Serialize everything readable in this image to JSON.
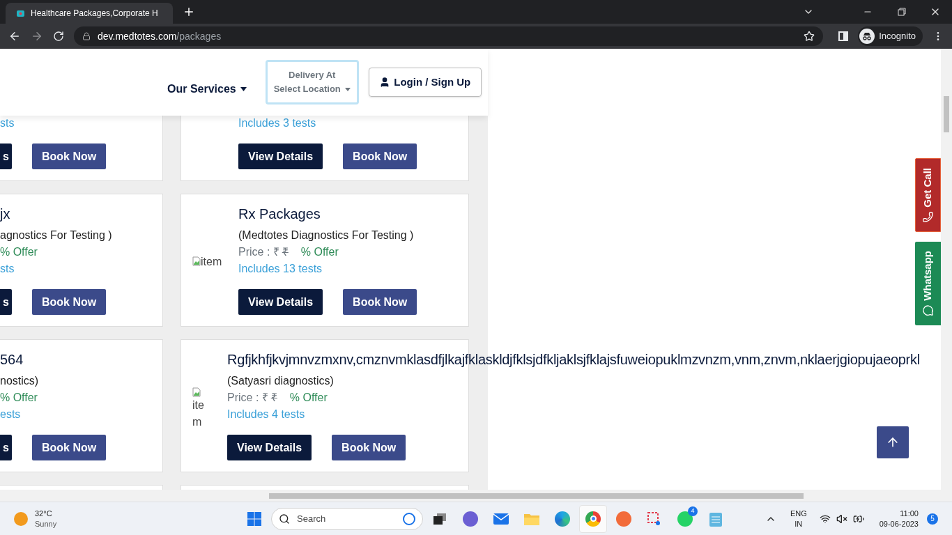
{
  "browser": {
    "tab_title": "Healthcare Packages,Corporate H",
    "url_host": "dev.medtotes.com",
    "url_path": "/packages",
    "profile": "Incognito"
  },
  "header": {
    "services": "Our Services",
    "delivery_label": "Delivery At",
    "delivery_value": "Select Location",
    "login": "Login / Sign Up"
  },
  "rows": [
    {
      "left": {
        "tests": "sts",
        "view_button": "s",
        "book_button": "Book Now"
      },
      "right": {
        "tests": "Includes 3 tests",
        "view_button": "View Details",
        "book_button": "Book Now"
      }
    },
    {
      "left": {
        "title": "jx",
        "provider": "agnostics For Testing )",
        "offer": "% Offer",
        "tests": "sts",
        "view_button": "s",
        "book_button": "Book Now"
      },
      "right": {
        "image_alt": "item",
        "title": "Rx Packages",
        "provider": "(Medtotes Diagnostics For Testing )",
        "price_label": "Price : ₹",
        "old_price": "₹",
        "offer": "% Offer",
        "tests": "Includes 13 tests",
        "view_button": "View Details",
        "book_button": "Book Now"
      }
    },
    {
      "left": {
        "title": "564",
        "provider": "nostics)",
        "offer": "% Offer",
        "tests": "ests",
        "view_button": "s",
        "book_button": "Book Now"
      },
      "right": {
        "image_alt": "item",
        "title": "Rgfjkhfjkvjmnvzmxnv,cmznvmklasdfjlkajfklaskldjfklsjdfkljaklsjfklajsfuweiopuklmzvnzm,vnm,znvm,nklaerjgiopujaeoprkl",
        "provider": "(Satyasri diagnostics)",
        "price_label": "Price : ₹",
        "old_price": "₹",
        "offer": "% Offer",
        "tests": "Includes 4 tests",
        "view_button": "View Details",
        "book_button": "Book Now"
      }
    }
  ],
  "side_buttons": [
    {
      "kind": "call",
      "label": "Get Call"
    },
    {
      "kind": "whatsapp",
      "label": "Whatsapp"
    }
  ],
  "taskbar": {
    "temperature": "32°C",
    "weather": "Sunny",
    "search_placeholder": "Search",
    "whatsapp_badge": "4",
    "language": "ENG",
    "region": "IN",
    "time": "11:00",
    "date": "09-06-2023",
    "notifications": "5"
  }
}
